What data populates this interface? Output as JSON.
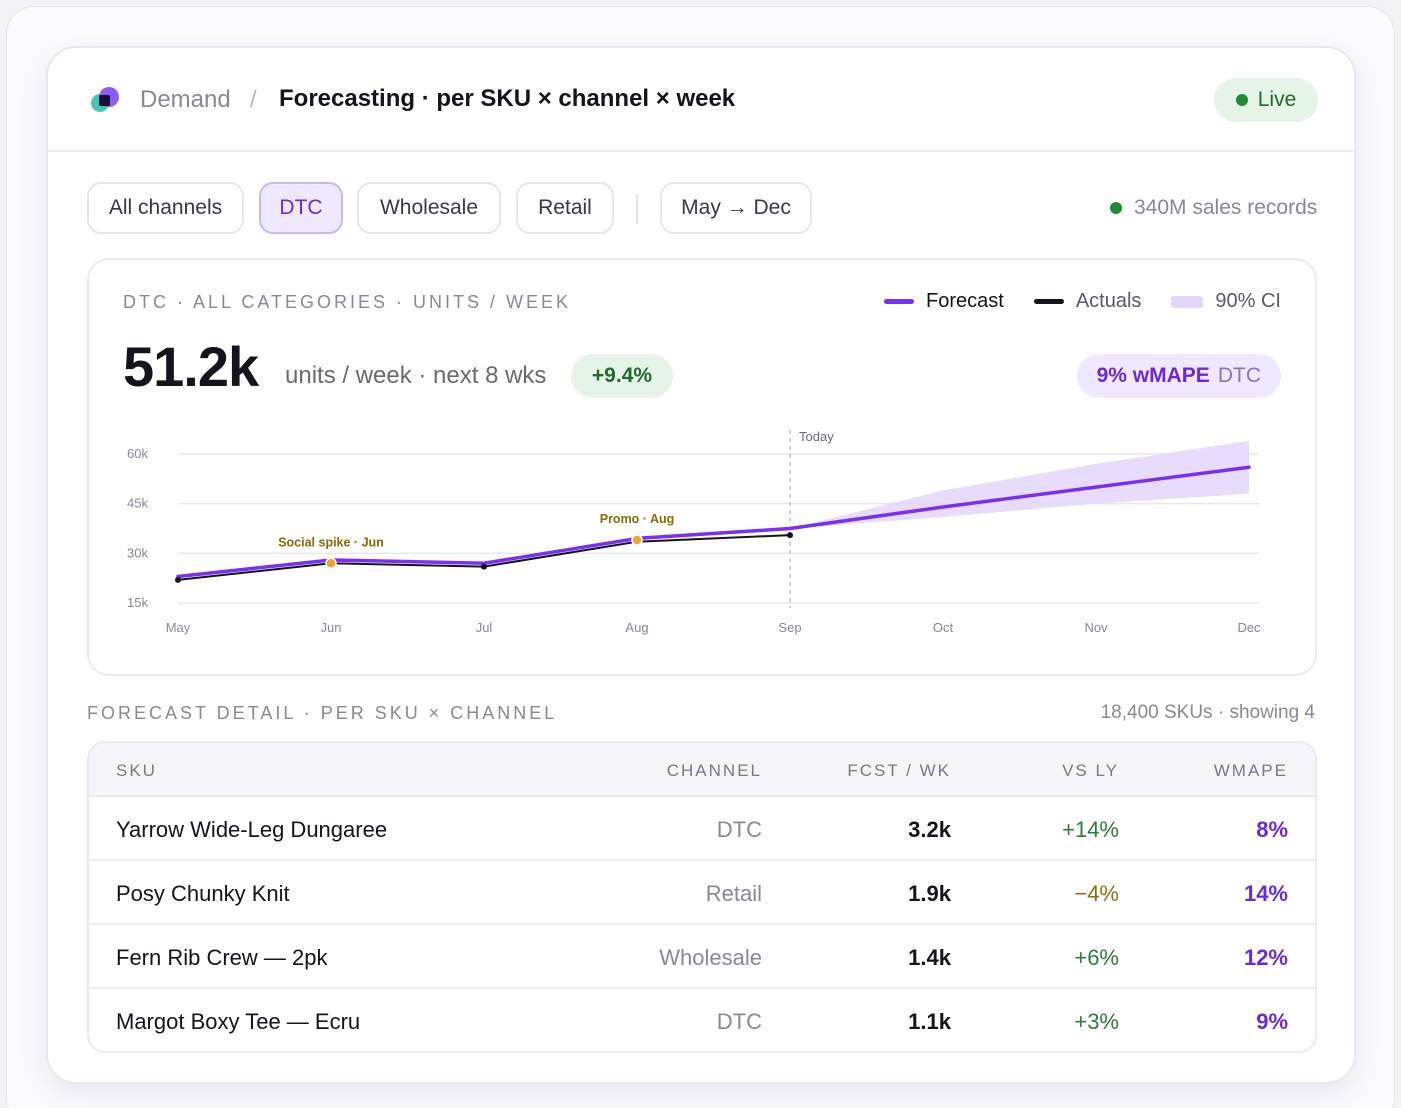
{
  "header": {
    "crumb_root": "Demand",
    "crumb_sep": "/",
    "crumb_page": "Forecasting · per SKU × channel × week",
    "status": "Live"
  },
  "filters": {
    "chips": [
      "All channels",
      "DTC",
      "Wholesale",
      "Retail"
    ],
    "active": "DTC",
    "range": "May → Dec",
    "records": "340M sales records"
  },
  "panel": {
    "title": "DTC · ALL CATEGORIES · UNITS / WEEK",
    "big_value": "51.2k",
    "big_sub": "units / week · next 8 wks",
    "delta": "+9.4%",
    "wmape_value": "9% wMAPE",
    "wmape_channel": "DTC",
    "legend": {
      "forecast": "Forecast",
      "actuals": "Actuals",
      "ci": "90% CI"
    }
  },
  "chart_data": {
    "type": "line",
    "x": [
      "May",
      "Jun",
      "Jul",
      "Aug",
      "Sep",
      "Oct",
      "Nov",
      "Dec"
    ],
    "y_ticks": [
      60000,
      45000,
      30000,
      15000
    ],
    "y_tick_labels": [
      "60k",
      "45k",
      "30k",
      "15k"
    ],
    "ylim": [
      15000,
      60000
    ],
    "series": [
      {
        "name": "Forecast",
        "values": [
          23000,
          28000,
          27000,
          34500,
          37500,
          44000,
          50000,
          56000
        ]
      },
      {
        "name": "Actuals",
        "values": [
          22000,
          27000,
          26000,
          33500,
          35500
        ]
      },
      {
        "name": "90% CI",
        "lower": [
          37500,
          41000,
          45000,
          48000
        ],
        "upper": [
          37500,
          49000,
          57000,
          64000
        ],
        "x_start_index": 4
      }
    ],
    "today_label": "Today",
    "today_index": 4,
    "annotations": [
      {
        "label": "Social spike · Jun",
        "x_index": 1,
        "value": 27000
      },
      {
        "label": "Promo · Aug",
        "x_index": 3,
        "value": 34000
      }
    ],
    "colors": {
      "forecast": "#7c2ff0",
      "actuals": "#15131c",
      "ci": "#e3d6fb",
      "annotation": "#f0a22e",
      "annotation_text": "#8a6a00"
    }
  },
  "table": {
    "title": "FORECAST DETAIL · PER SKU × CHANNEL",
    "meta": "18,400 SKUs · showing 4",
    "columns": [
      "SKU",
      "CHANNEL",
      "FCST / WK",
      "VS LY",
      "WMAPE"
    ],
    "rows": [
      {
        "sku": "Yarrow Wide-Leg Dungaree",
        "channel": "DTC",
        "fcst": "3.2k",
        "vs_ly": "+14%",
        "wmape": "8%"
      },
      {
        "sku": "Posy Chunky Knit",
        "channel": "Retail",
        "fcst": "1.9k",
        "vs_ly": "−4%",
        "wmape": "14%"
      },
      {
        "sku": "Fern Rib Crew — 2pk",
        "channel": "Wholesale",
        "fcst": "1.4k",
        "vs_ly": "+6%",
        "wmape": "12%"
      },
      {
        "sku": "Margot Boxy Tee — Ecru",
        "channel": "DTC",
        "fcst": "1.1k",
        "vs_ly": "+3%",
        "wmape": "9%"
      }
    ]
  },
  "colors": {
    "accent": "#6d28d9",
    "live": "#1f8a32"
  }
}
